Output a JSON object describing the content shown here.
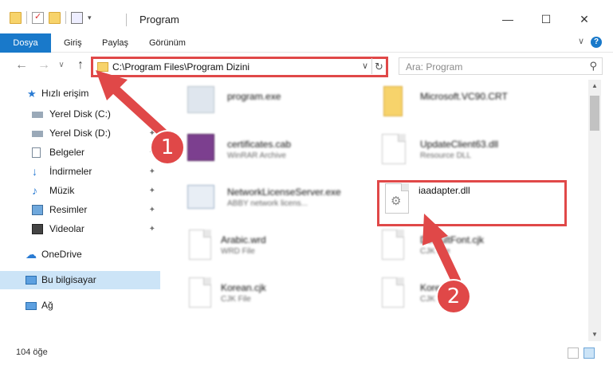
{
  "window": {
    "title": "Program",
    "minimize": "—",
    "maximize": "☐",
    "close": "✕"
  },
  "ribbon": {
    "tabs": [
      "Dosya",
      "Giriş",
      "Paylaş",
      "Görünüm"
    ],
    "expand_glyph": "∨",
    "help_glyph": "?"
  },
  "nav": {
    "back_glyph": "←",
    "forward_glyph": "→",
    "recent_glyph": "∨",
    "up_glyph": "↑",
    "address_path": "C:\\Program Files\\Program Dizini",
    "address_dropdown_glyph": "∨",
    "refresh_glyph": "↻",
    "search_placeholder": "Ara: Program",
    "search_glyph": "⚲"
  },
  "sidebar": {
    "items": [
      {
        "label": "Hızlı erişim",
        "icon": "star-icon"
      },
      {
        "label": "Yerel Disk (C:)",
        "icon": "drive-icon"
      },
      {
        "label": "Yerel Disk (D:)",
        "icon": "drive-icon"
      },
      {
        "label": "Belgeler",
        "icon": "documents-icon"
      },
      {
        "label": "İndirmeler",
        "icon": "download-icon"
      },
      {
        "label": "Müzik",
        "icon": "music-icon"
      },
      {
        "label": "Resimler",
        "icon": "pictures-icon"
      },
      {
        "label": "Videolar",
        "icon": "videos-icon"
      },
      {
        "label": "OneDrive",
        "icon": "cloud-icon"
      },
      {
        "label": "Bu bilgisayar",
        "icon": "computer-icon"
      },
      {
        "label": "Ağ",
        "icon": "network-icon"
      }
    ],
    "pin_glyph": "📌"
  },
  "files": [
    {
      "name": "program.exe",
      "type": ""
    },
    {
      "name": "Microsoft.VC90.CRT",
      "type": ""
    },
    {
      "name": "certificates.cab",
      "type": "WinRAR Archive"
    },
    {
      "name": "UpdateClient63.dll",
      "type": "Resource DLL"
    },
    {
      "name": "NetworkLicenseServer.exe",
      "type": "ABBY network licens..."
    },
    {
      "name": "iaadapter.dll",
      "type": ""
    },
    {
      "name": "Arabic.wrd",
      "type": "WRD File"
    },
    {
      "name": "DefaultFont.cjk",
      "type": "CJK File"
    },
    {
      "name": "Korean.cjk",
      "type": "CJK File"
    },
    {
      "name": "Korean.cjk",
      "type": "CJK File"
    }
  ],
  "status": {
    "item_count": "104 öğe"
  },
  "annotations": {
    "step1": "1",
    "step2": "2",
    "color": "#e04848"
  },
  "colors": {
    "accent": "#1979ca",
    "selected": "#cce4f7"
  }
}
